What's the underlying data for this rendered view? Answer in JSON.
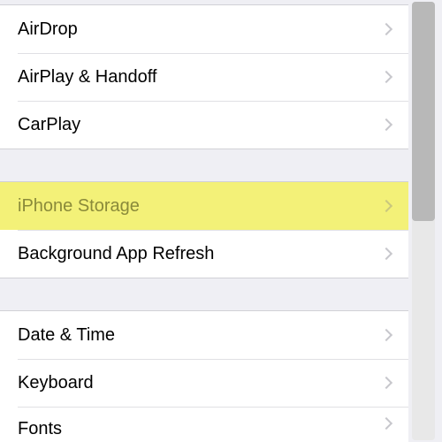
{
  "groups": [
    {
      "items": [
        {
          "key": "airdrop",
          "label": "AirDrop"
        },
        {
          "key": "airplay",
          "label": "AirPlay & Handoff"
        },
        {
          "key": "carplay",
          "label": "CarPlay"
        }
      ]
    },
    {
      "items": [
        {
          "key": "iphone-storage",
          "label": "iPhone Storage",
          "highlighted": true
        },
        {
          "key": "background-refresh",
          "label": "Background App Refresh"
        }
      ]
    },
    {
      "items": [
        {
          "key": "date-time",
          "label": "Date & Time"
        },
        {
          "key": "keyboard",
          "label": "Keyboard"
        },
        {
          "key": "fonts",
          "label": "Fonts"
        }
      ]
    }
  ]
}
